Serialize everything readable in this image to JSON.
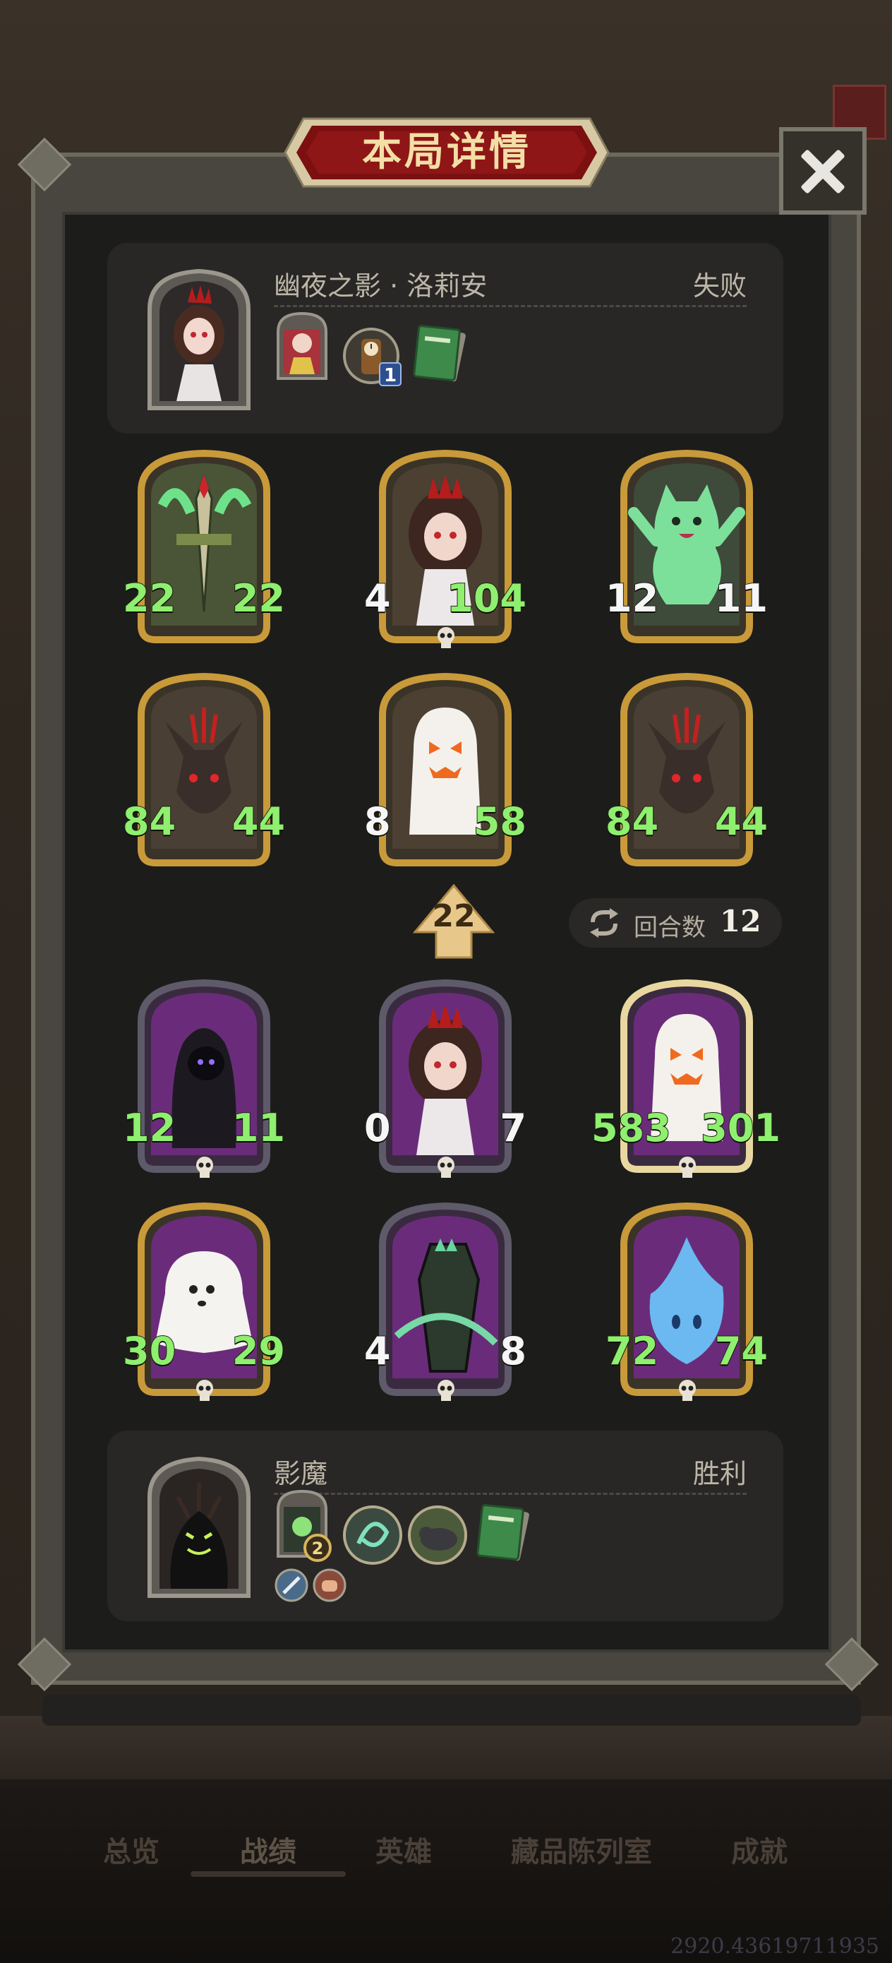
{
  "title": "本局详情",
  "bottom_nav": {
    "tabs": [
      "总览",
      "战绩",
      "英雄",
      "藏品陈列室",
      "成就"
    ],
    "active": "战绩"
  },
  "watermark": "2920.43619711935",
  "opponent": {
    "name": "幽夜之影 · 洛莉安",
    "result": "失败",
    "hero_icon": "vampire-girl",
    "items": [
      {
        "icon": "hero-power-portrait"
      },
      {
        "icon": "clock-trinket",
        "count": "1"
      },
      {
        "icon": "green-book"
      }
    ]
  },
  "opponent_board": [
    {
      "art": "sword",
      "attack": "22",
      "health": "22",
      "border": "gold",
      "deathrattle": false
    },
    {
      "art": "vampire-girl",
      "attack": "4",
      "health": "104",
      "border": "gold",
      "deathrattle": true
    },
    {
      "art": "ghost-cat",
      "attack": "12",
      "health": "11",
      "border": "gold",
      "deathrattle": false
    },
    {
      "art": "bat",
      "attack": "84",
      "health": "44",
      "border": "gold",
      "deathrattle": false
    },
    {
      "art": "pumpkin-ghost",
      "attack": "8",
      "health": "58",
      "border": "gold",
      "deathrattle": false
    },
    {
      "art": "bat",
      "attack": "84",
      "health": "44",
      "border": "gold",
      "deathrattle": false
    }
  ],
  "tier": "22",
  "turns": {
    "label": "回合数",
    "value": "12"
  },
  "player_board": [
    {
      "art": "reaper",
      "attack": "12",
      "health": "11",
      "border": "purple",
      "deathrattle": true
    },
    {
      "art": "vampire-girl",
      "attack": "0",
      "health": "7",
      "border": "purple",
      "deathrattle": true
    },
    {
      "art": "pumpkin-ghost",
      "attack": "583",
      "health": "301",
      "border": "glow",
      "deathrattle": true
    },
    {
      "art": "ghost",
      "attack": "30",
      "health": "29",
      "border": "gold",
      "deathrattle": true
    },
    {
      "art": "coffin",
      "attack": "4",
      "health": "8",
      "border": "purple",
      "deathrattle": true
    },
    {
      "art": "blue-flame",
      "attack": "72",
      "health": "74",
      "border": "gold",
      "deathrattle": true
    }
  ],
  "player": {
    "name": "影魔",
    "result": "胜利",
    "hero_icon": "shadow-demon",
    "items": [
      {
        "icon": "hero-power-portrait",
        "count": "2"
      },
      {
        "icon": "swirl-orb"
      },
      {
        "icon": "rhino-orb"
      },
      {
        "icon": "green-book"
      }
    ],
    "buffs": [
      {
        "icon": "sword-buff"
      },
      {
        "icon": "fist-buff"
      }
    ]
  }
}
